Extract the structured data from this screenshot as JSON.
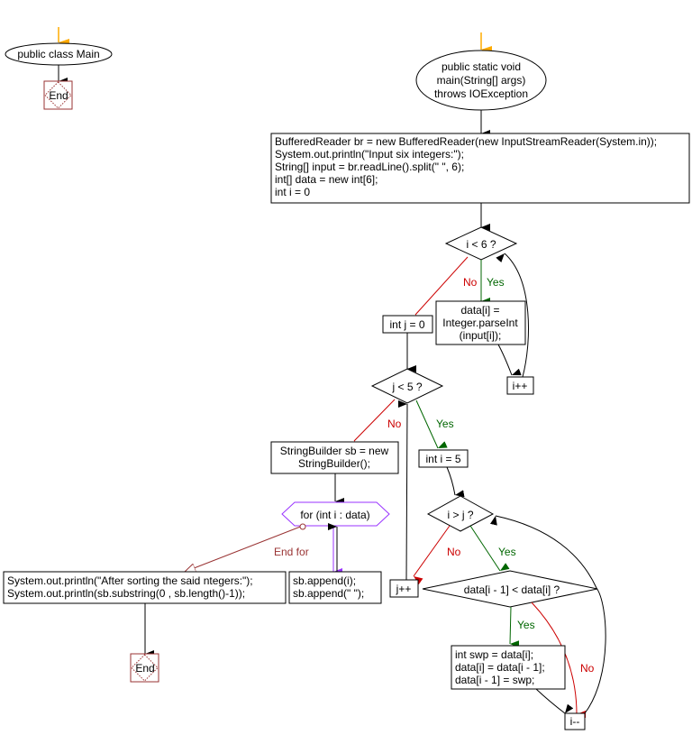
{
  "colors": {
    "start_arrow": "#ffaa00",
    "end_border": "#993333",
    "no_branch": "#cc0000",
    "yes_branch": "#006600",
    "loop_for": "#9933ff",
    "end_for": "#993333"
  },
  "class_chart": {
    "class_node": "public class Main",
    "end_label": "End"
  },
  "main_chart": {
    "method_node": [
      "public static void",
      "main(String[] args)",
      "throws IOException"
    ],
    "init_block": [
      "BufferedReader br = new BufferedReader(new InputStreamReader(System.in));",
      "System.out.println(\"Input six integers:\");",
      "String[] input = br.readLine().split(\" \", 6);",
      "int[] data = new int[6];",
      "int i = 0"
    ],
    "cond_i_lt_6": "i < 6 ?",
    "parse_block": [
      "data[i] =",
      "Integer.parseInt",
      "(input[i]);"
    ],
    "i_inc": "i++",
    "init_j": "int j = 0",
    "cond_j_lt_5": "j < 5 ?",
    "sb_block": [
      "StringBuilder sb = new",
      "StringBuilder();"
    ],
    "init_i5": "int i = 5",
    "for_loop": "for (int i : data)",
    "end_for_label": "End for",
    "print_block": [
      "System.out.println(\"After sorting the said ntegers:\");",
      "System.out.println(sb.substring(0 , sb.length()-1));"
    ],
    "append_block": [
      "sb.append(i);",
      "sb.append(\" \");"
    ],
    "cond_i_gt_j": "i > j ?",
    "j_inc": "j++",
    "cond_compare": "data[i - 1] < data[i] ?",
    "swap_block": [
      "int swp = data[i];",
      "data[i] = data[i - 1];",
      "data[i - 1] = swp;"
    ],
    "i_dec": "i--",
    "end_label": "End",
    "yes_label": "Yes",
    "no_label": "No"
  }
}
